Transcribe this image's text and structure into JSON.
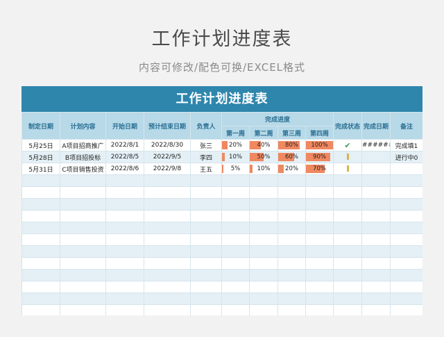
{
  "page": {
    "title": "工作计划进度表",
    "subtitle": "内容可修改/配色可换/EXCEL格式"
  },
  "sheet": {
    "banner": "工作计划进度表",
    "headers": {
      "date_set": "制定日期",
      "content": "计划内容",
      "start": "开始日期",
      "planned_end": "预计结束日期",
      "owner": "负责人",
      "progress": "完成进度",
      "status": "完成状态",
      "done_date": "完成日期",
      "note": "备注",
      "week1": "第一周",
      "week2": "第二周",
      "week3": "第三周",
      "week4": "第四周"
    },
    "rows": [
      {
        "date_set": "5月25日",
        "content": "A项目招商推广",
        "start": "2022/8/1",
        "planned_end": "2022/8/30",
        "owner": "张三",
        "weeks": [
          "20%",
          "40%",
          "80%",
          "100%"
        ],
        "week_levels": [
          0.2,
          0.4,
          0.8,
          1.0
        ],
        "status_icon": "check-icon",
        "done_date": "#######",
        "note": "完成填1"
      },
      {
        "date_set": "5月28日",
        "content": "B项目招投标",
        "start": "2022/8/5",
        "planned_end": "2022/9/5",
        "owner": "李四",
        "weeks": [
          "10%",
          "50%",
          "60%",
          "90%"
        ],
        "week_levels": [
          0.1,
          0.5,
          0.6,
          0.9
        ],
        "status_icon": "pending-icon",
        "done_date": "",
        "note": "进行中0"
      },
      {
        "date_set": "5月31日",
        "content": "C项目销售投资",
        "start": "2022/8/6",
        "planned_end": "2022/9/8",
        "owner": "王五",
        "weeks": [
          "5%",
          "10%",
          "20%",
          "70%"
        ],
        "week_levels": [
          0.05,
          0.1,
          0.2,
          0.7
        ],
        "status_icon": "pending-icon",
        "done_date": "",
        "note": ""
      }
    ],
    "empty_rows": 14
  },
  "colors": {
    "banner": "#2e86ad",
    "header_bg": "#b7d9e8",
    "bar": "#f08860",
    "stripe": "#e4f0f6"
  }
}
